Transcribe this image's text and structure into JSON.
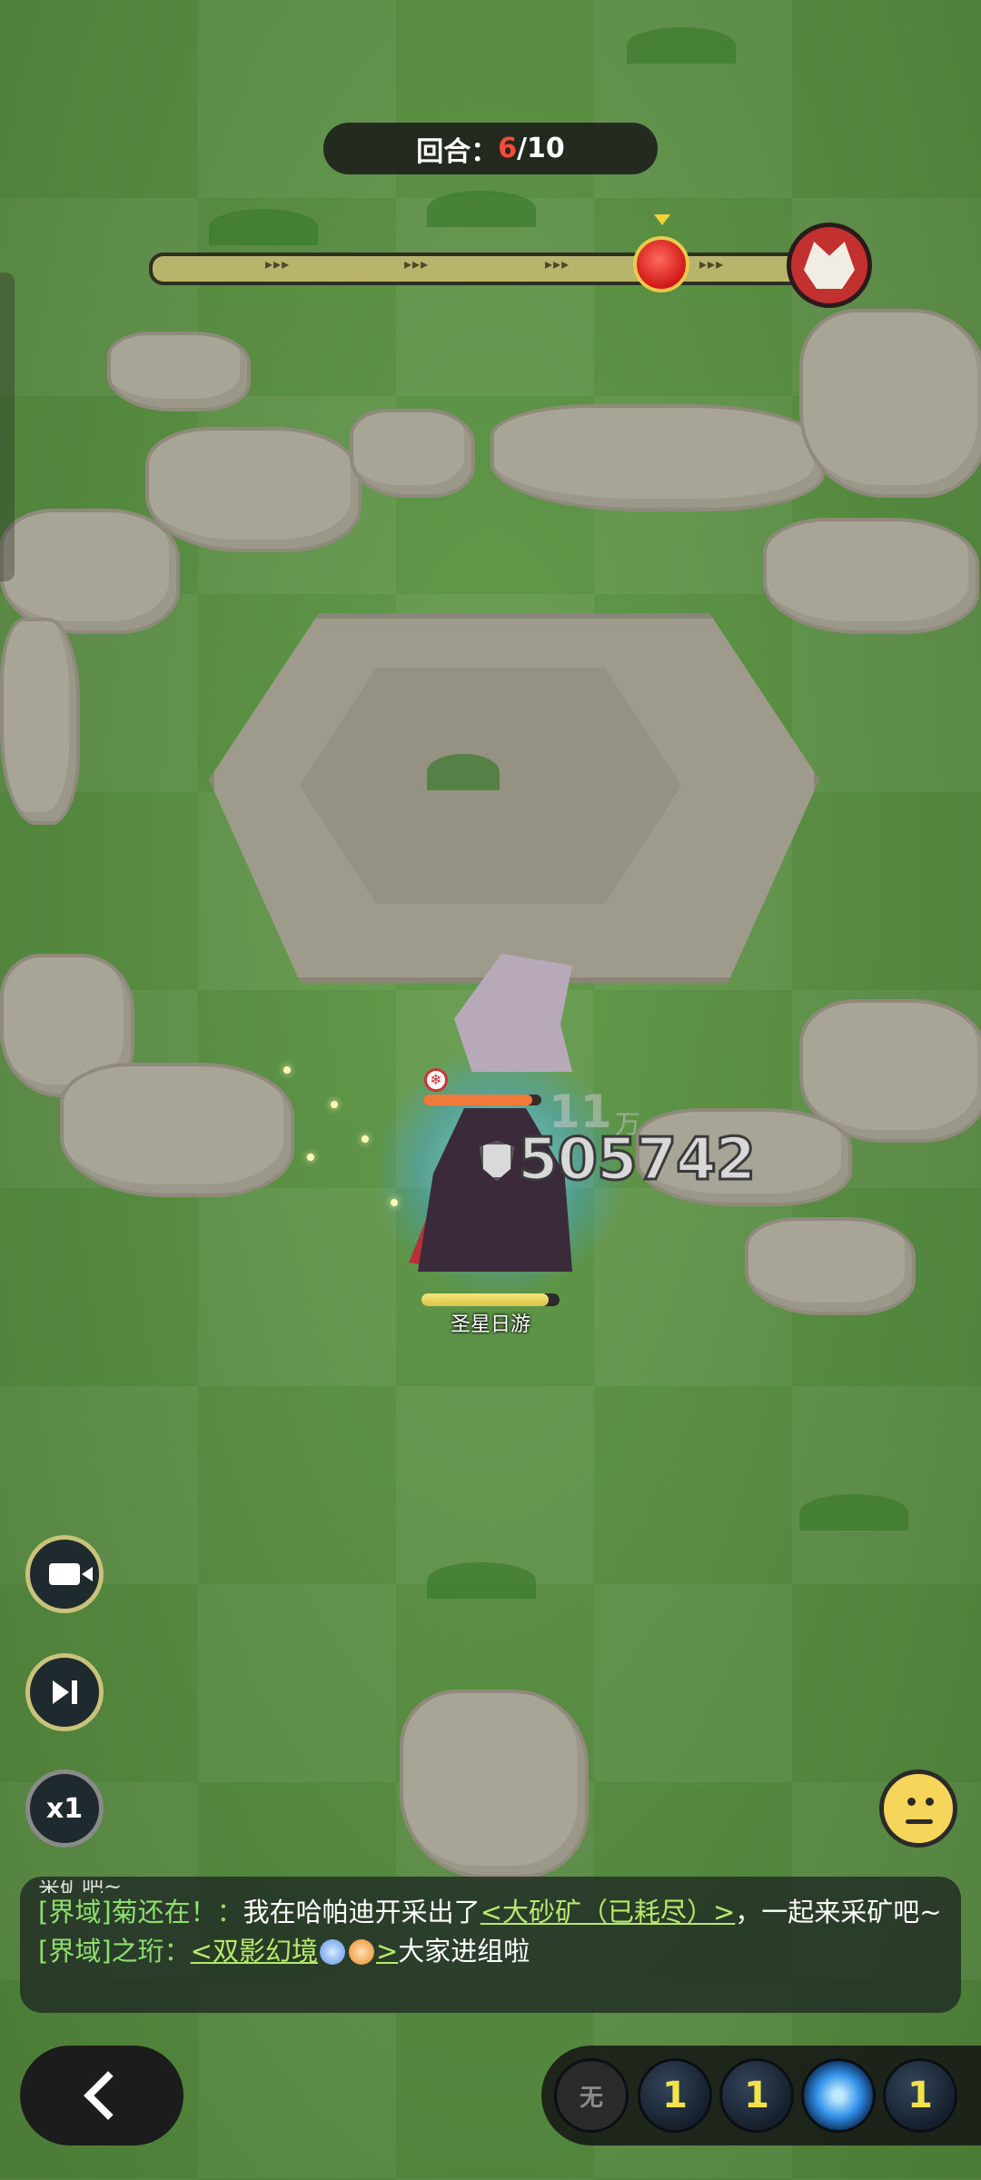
{
  "hud": {
    "round_label": "回合：",
    "round_current": "6",
    "round_total": "/10",
    "track_arrows": "▸▸▸"
  },
  "battle": {
    "hero_name": "圣星日游",
    "damage_value": "505742",
    "faded_value": "11",
    "faded_unit": "万",
    "hero_hp_fraction": 0.92,
    "enemy_hp_fraction": 0.92
  },
  "controls": {
    "speed_label": "x1"
  },
  "chat": {
    "cut_line": "采矿吧~",
    "messages": [
      {
        "channel": "[界域]",
        "sender": "菊还在！",
        "sep": "：",
        "text_before": "我在哈帕迪开采出了",
        "link": "<大砂矿（已耗尽）>",
        "text_after": "，一起来采矿吧~"
      },
      {
        "channel": "[界域]",
        "sender": "之珩",
        "sep": "：",
        "text_before": "",
        "link_open": "<双影幻境",
        "link_close": ">",
        "text_after": "大家进组啦"
      }
    ]
  },
  "skills": {
    "slot_empty_label": "无",
    "slot_counts": [
      "1",
      "1",
      "1"
    ]
  },
  "colors": {
    "round_current": "#ff4a3a",
    "chat_channel": "#8fdf6e",
    "chat_link": "#b7ea6a",
    "skill_count": "#f4e24a"
  }
}
